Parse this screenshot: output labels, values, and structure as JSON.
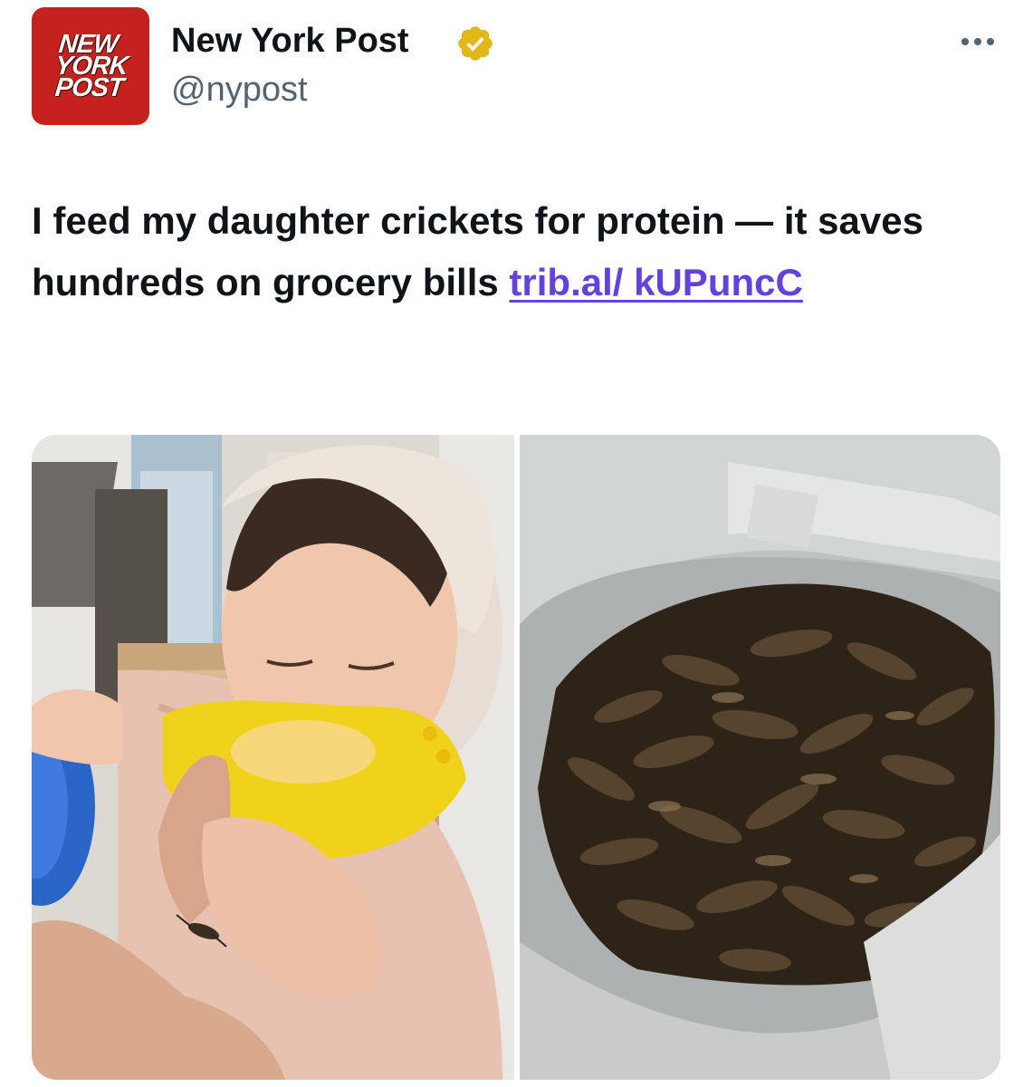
{
  "author": {
    "avatar_logo_lines": [
      "NEW",
      "YORK",
      "POST"
    ],
    "display_name": "New York Post",
    "handle": "@nypost",
    "verified": true,
    "verified_badge_color": "#e2b719"
  },
  "tweet": {
    "text_before_link": "I feed my daughter crickets for protein — it saves hundreds on grocery bills ",
    "link_text": "trib.al/ kUPuncC",
    "link_color": "#6441dd"
  },
  "media": {
    "photos": [
      {
        "icon": "photo-baby-with-cricket"
      },
      {
        "icon": "photo-bag-of-crickets"
      }
    ]
  },
  "colors": {
    "brand_red": "#c5221f",
    "text": "#0f1419",
    "secondary_text": "#536471"
  }
}
